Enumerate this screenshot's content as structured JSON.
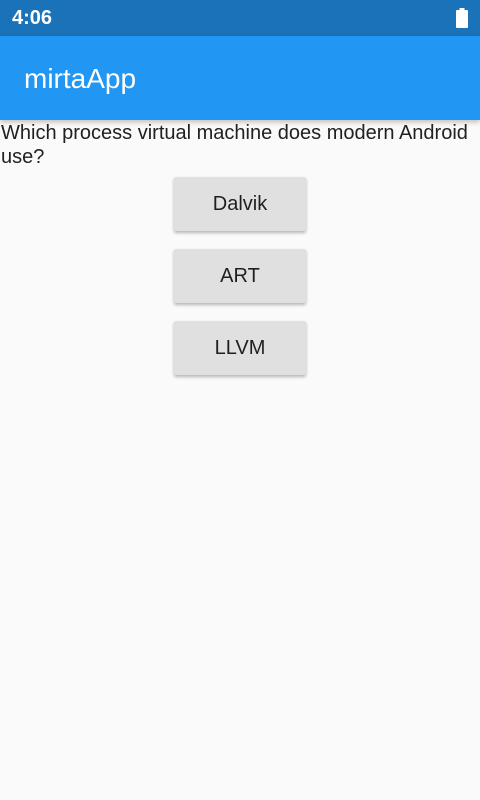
{
  "status_bar": {
    "time": "4:06",
    "battery_icon": "battery-full-icon"
  },
  "app_bar": {
    "title": "mirtaApp"
  },
  "quiz": {
    "question": "Which process virtual machine does modern Android use?",
    "answers": [
      "Dalvik",
      "ART",
      "LLVM"
    ]
  },
  "colors": {
    "status_bar": "#1a73b9",
    "app_bar": "#2196f3",
    "background": "#fafafa",
    "button": "#e0e0e0"
  }
}
